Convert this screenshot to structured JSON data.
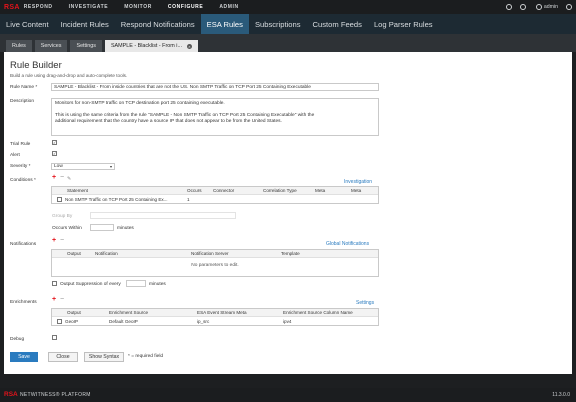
{
  "topbar": {
    "logo": "RSA",
    "nav": [
      "RESPOND",
      "INVESTIGATE",
      "MONITOR",
      "CONFIGURE",
      "ADMIN"
    ],
    "active_nav": "CONFIGURE",
    "user": "admin"
  },
  "subnav": [
    "Live Content",
    "Incident Rules",
    "Respond Notifications",
    "ESA Rules",
    "Subscriptions",
    "Custom Feeds",
    "Log Parser Rules"
  ],
  "subnav_active": "ESA Rules",
  "tabs": [
    "Rules",
    "Services",
    "Settings",
    "SAMPLE - Blacklist - From i..."
  ],
  "page": {
    "title": "Rule Builder",
    "subtitle": "Build a rule using drag-and-drop and auto-complete tools."
  },
  "form": {
    "rule_name_label": "Rule Name *",
    "rule_name_value": "SAMPLE - Blacklist - From inside countries that are not the US. Non SMTP Traffic on TCP Port 25 Containing Executable",
    "description_label": "Description",
    "description_line1": "Monitors for non-SMTP traffic on TCP destination port 25 containing executable.",
    "description_line2": "This is using the same criteria from the rule \"SAMPLE - Non SMTP Traffic on TCP Port 25 Containing Executable\" with the",
    "description_line3": "additional requirement that the country have a source IP that does not appear to be from the United States.",
    "trial_rule_label": "Trial Rule",
    "alert_label": "Alert",
    "severity_label": "Severity *",
    "severity_value": "Low",
    "conditions_label": "Conditions *",
    "investigation_link": "Investigation",
    "group_by_label": "Group By",
    "occurs_within_label": "Occurs Within",
    "minutes_label": "minutes",
    "notifications_label": "Notifications",
    "global_notifications_link": "Global Notifications",
    "no_params_text": "No parameters to edit.",
    "output_suppression_label": "Output Suppression of every",
    "minutes_label2": "minutes",
    "enrichments_label": "Enrichments",
    "settings_link": "Settings",
    "debug_label": "Debug",
    "required_note": "* = required field"
  },
  "conditions_table": {
    "headers": [
      "Statement",
      "Occurs",
      "Connector",
      "Correlation Type",
      "Meta",
      "Meta"
    ],
    "rows": [
      [
        "Non SMTP Traffic on TCP Port 25 Containing Ex...",
        "1",
        "",
        "",
        "",
        ""
      ]
    ]
  },
  "notifications_table": {
    "headers": [
      "Output",
      "Notification",
      "Notification Server",
      "Template"
    ]
  },
  "enrichments_table": {
    "headers": [
      "Output",
      "Enrichment Source",
      "ESA Event Stream Meta",
      "Enrichment Source Column Name"
    ],
    "rows": [
      [
        "GeoIP",
        "Default GeoIP",
        "ip_src",
        "ipv4"
      ]
    ]
  },
  "buttons": {
    "save": "Save",
    "close": "Close",
    "show_syntax": "Show Syntax"
  },
  "footer": {
    "brand": "RSA",
    "platform": "NETWITNESS® PLATFORM",
    "version": "11.3.0.0"
  },
  "colors": {
    "accent": "#2a7bbf",
    "brand_red": "#e4131b",
    "active_tab": "#2a5a7a"
  }
}
